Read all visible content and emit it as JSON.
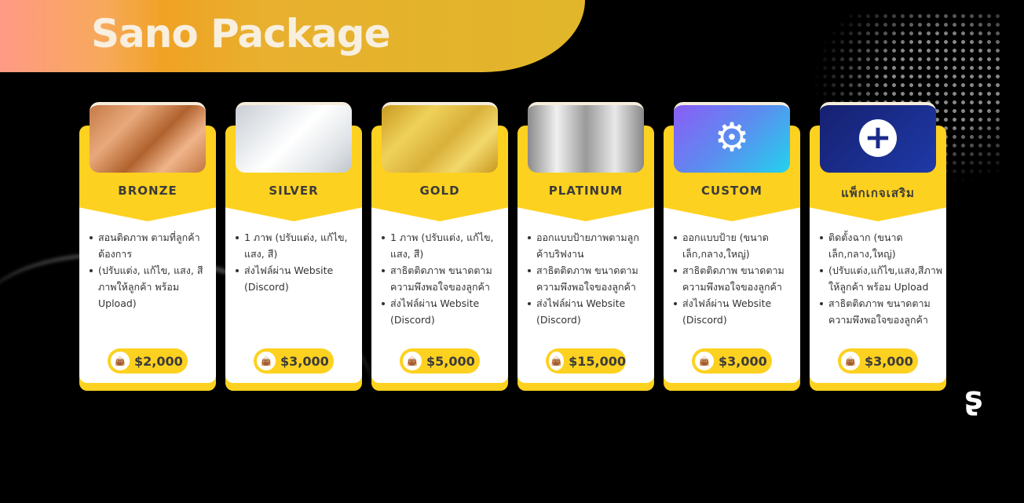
{
  "title": "Sano Package",
  "cards": [
    {
      "name": "BRONZE",
      "price": "$2,000",
      "color": "#b87040",
      "items": [
        "สอนติดภาพ ตามที่ลูกค้าต้องการ",
        "(ปรับแต่ง, แก้ไข, แสง, สี ภาพให้ลูกค้า พร้อม Upload)"
      ]
    },
    {
      "name": "SILVER",
      "price": "$3,000",
      "color": "#d8dde2",
      "items": [
        "1 ภาพ (ปรับแต่ง, แก้ไข, แสง, สี)",
        "ส่งไฟล์ผ่าน Website (Discord)"
      ]
    },
    {
      "name": "GOLD",
      "price": "$5,000",
      "color": "#d8ae2e",
      "items": [
        "1 ภาพ (ปรับแต่ง, แก้ไข, แสง, สี)",
        "สาธิตติดภาพ ขนาดตามความพึงพอใจของลูกค้า",
        "ส่งไฟล์ผ่าน Website (Discord)"
      ]
    },
    {
      "name": "PLATINUM",
      "price": "$15,000",
      "color": "#b0b0b0",
      "items": [
        "ออกแบบป้ายภาพตามลูกค้าบริฟงาน",
        "สาธิตติดภาพ ขนาดตามความพึงพอใจของลูกค้า",
        "ส่งไฟล์ผ่าน Website (Discord)"
      ]
    },
    {
      "name": "CUSTOM",
      "price": "$3,000",
      "color": "#6a7cf0",
      "items": [
        "ออกแบบป้าย (ขนาดเล็ก,กลาง,ใหญ่)",
        "สาธิตติดภาพ ขนาดตามความพึงพอใจของลูกค้า",
        "ส่งไฟล์ผ่าน Website (Discord)"
      ]
    },
    {
      "name": "แพ็กเกจเสริม",
      "price": "$3,000",
      "color": "#1a2a8a",
      "items": [
        "ติดตั้งฉาก (ขนาดเล็ก,กลาง,ใหญ่)",
        "(ปรับแต่ง,แก้ไข,แสง,สีภาพให้ลูกค้า พร้อม Upload",
        "สาธิตติดภาพ ขนาดตามความพึงพอใจของลูกค้า"
      ]
    }
  ]
}
